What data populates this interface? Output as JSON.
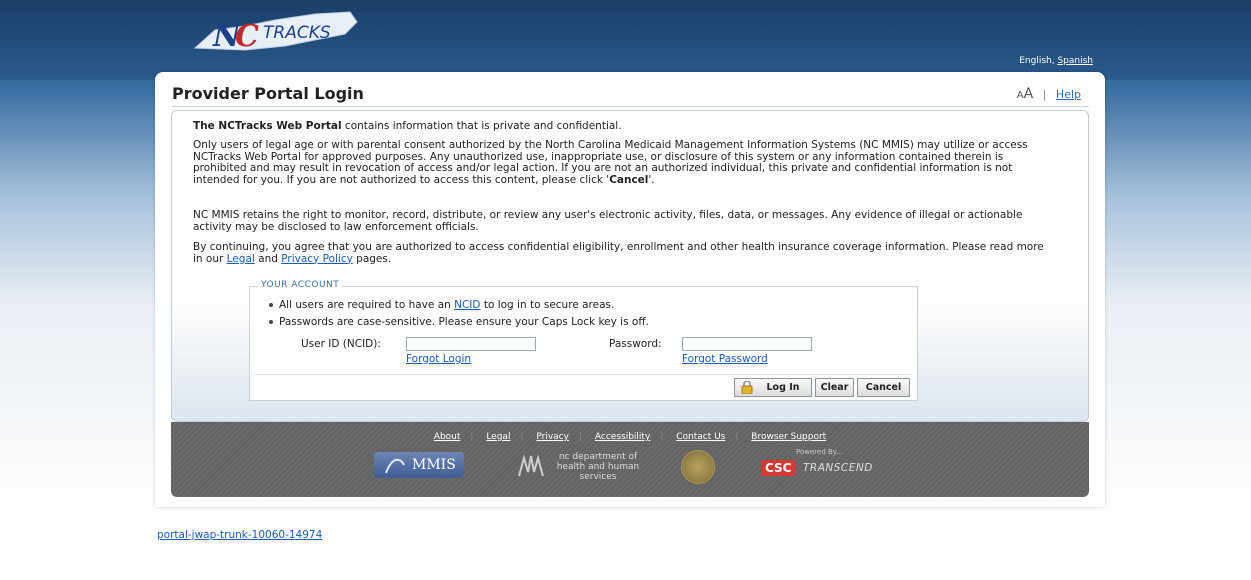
{
  "header": {
    "logo_text": "NCTRACKS",
    "lang_current": "English,",
    "lang_other": "Spanish"
  },
  "page": {
    "title": "Provider Portal Login",
    "font_small": "A",
    "font_large": "A",
    "separator": "|",
    "help": "Help"
  },
  "notice": {
    "p1_bold": "The NCTracks Web Portal",
    "p1_rest": " contains information that is private and confidential.",
    "p2_a": "Only users of legal age or with parental consent authorized by the North Carolina Medicaid Management Information Systems (NC MMIS) may utilize or access NCTracks Web Portal for approved purposes. Any unauthorized use, inappropriate use, or disclosure of this system or any information contained therein is prohibited and may result in revocation of access and/or legal action. If you are not an authorized individual, this private and confidential information is not intended for you. If you are not authorized to access this content, please click '",
    "p2_cancel": "Cancel",
    "p2_end": "'.",
    "p3": "NC MMIS retains the right to monitor, record, distribute, or review any user's electronic activity, files, data, or messages. Any evidence of illegal or actionable activity may be disclosed to law enforcement officials.",
    "p4_a": "By continuing, you agree that you are authorized to access confidential eligibility, enrollment and other health insurance coverage information. Please read more in our ",
    "p4_legal": "Legal",
    "p4_and": " and ",
    "p4_privacy": "Privacy Policy",
    "p4_end": " pages."
  },
  "account": {
    "legend": "YOUR ACCOUNT",
    "bullet1_a": "All users are required to have an ",
    "bullet1_link": "NCID",
    "bullet1_b": "  to log in to secure areas.",
    "bullet2": "Passwords are case-sensitive. Please ensure your Caps Lock key is off.",
    "userid_label": "User ID (NCID):",
    "userid_value": "",
    "forgot_login": "Forgot Login",
    "password_label": "Password:",
    "password_value": "",
    "forgot_password": "Forgot Password",
    "login_button": "Log In",
    "clear_button": "Clear",
    "cancel_button": "Cancel"
  },
  "footer": {
    "links": [
      "About",
      "Legal",
      "Privacy",
      "Accessibility",
      "Contact Us",
      "Browser Support"
    ],
    "mmis_big": "MMIS",
    "dhhs_text": "nc department of health and human services",
    "powered_by": "Powered By...",
    "csc": "CSC",
    "transcend": "TRANSCEND"
  },
  "build_link": "portal-jwap-trunk-10060-14974",
  "colors": {
    "header_blue": "#1d4774",
    "link_blue": "#1a5bb5",
    "footer_gray": "#666666",
    "csc_red": "#d23b32"
  },
  "icons": [
    "nc-state-map-logo",
    "lock-icon",
    "state-seal-logo"
  ]
}
